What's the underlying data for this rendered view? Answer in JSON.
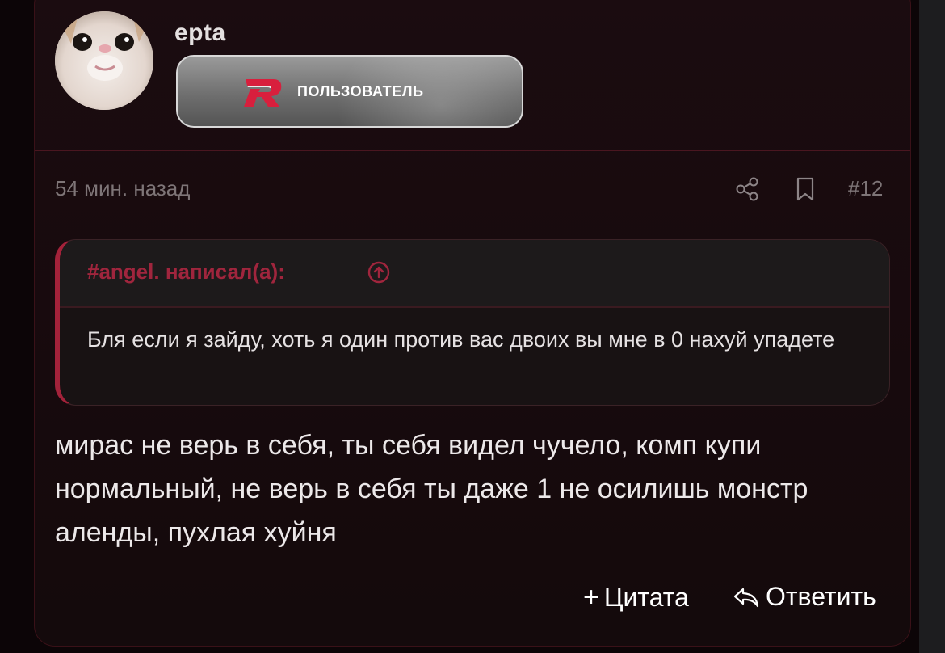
{
  "post": {
    "username": "epta",
    "role_label": "ПОЛЬЗОВАТЕЛЬ",
    "timestamp": "54 мин. назад",
    "post_number": "#12",
    "quote": {
      "author_line": "#angel. написал(а):",
      "text": "Бля если я зайду, хоть я один против вас двоих вы мне в 0 нахуй упадете"
    },
    "message": "мирас не верь в себя, ты себя видел чучело, комп купи нормальный, не верь в себя ты даже 1 не осилишь монстр аленды, пухлая хуйня",
    "actions": {
      "quote_label": "Цитата",
      "reply_label": "Ответить"
    }
  },
  "icons": {
    "share": "share-icon",
    "bookmark": "bookmark-icon",
    "jump_to_quote": "arrow-up-circle-icon",
    "plus": "plus-icon",
    "reply": "reply-icon",
    "role_logo": "r-logo-icon"
  },
  "colors": {
    "accent": "#a0253d",
    "background": "#170a0d",
    "muted_text": "#7e7577"
  }
}
